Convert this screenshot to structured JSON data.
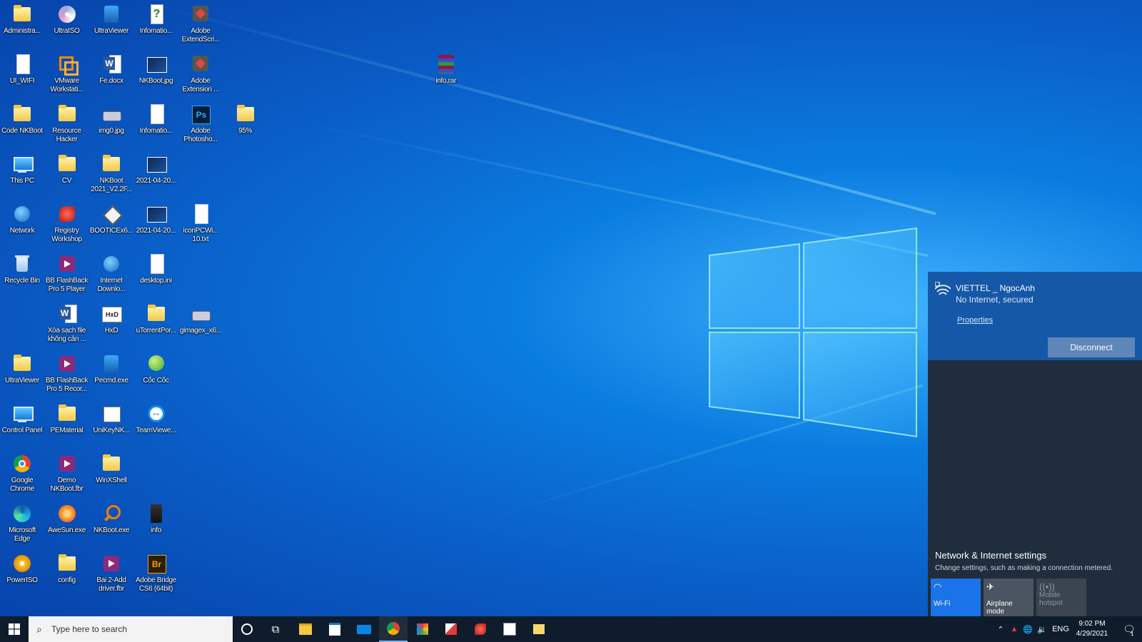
{
  "desktop_icons": [
    {
      "label": "Administra...",
      "icon": "folder-user-icon",
      "kind": "folder"
    },
    {
      "label": "UltraISO",
      "icon": "ultraiso-icon",
      "kind": "iso"
    },
    {
      "label": "UltraViewer",
      "icon": "ultraviewer-icon",
      "kind": "exe"
    },
    {
      "label": "Infomatio...",
      "icon": "help-document-icon",
      "kind": "help"
    },
    {
      "label": "Adobe\nExtendScri...",
      "icon": "adobe-extendscript-icon",
      "kind": "adobe"
    },
    {
      "label": "UI_WIFI",
      "icon": "document-icon",
      "kind": "doc"
    },
    {
      "label": "VMware\nWorkstati...",
      "icon": "vmware-icon",
      "kind": "vm"
    },
    {
      "label": "Fe.docx",
      "icon": "word-document-icon",
      "kind": "word"
    },
    {
      "label": "NKBoot.jpg",
      "icon": "image-file-icon",
      "kind": "img"
    },
    {
      "label": "Adobe\nExtension ...",
      "icon": "adobe-extension-icon",
      "kind": "adobe"
    },
    {
      "label": "info.rar",
      "icon": "winrar-archive-icon",
      "kind": "rar"
    },
    {
      "label": "Code NKBoot",
      "icon": "folder-icon",
      "kind": "folder"
    },
    {
      "label": "Resource\nHacker",
      "icon": "folder-icon",
      "kind": "folder"
    },
    {
      "label": "img0.jpg",
      "icon": "image-file-icon",
      "kind": "disk"
    },
    {
      "label": "Infomatio...",
      "icon": "document-icon",
      "kind": "doc"
    },
    {
      "label": "Adobe\nPhotosho...",
      "icon": "photoshop-icon",
      "kind": "ps"
    },
    {
      "label": "95%",
      "icon": "folder-icon",
      "kind": "folder"
    },
    {
      "label": "This PC",
      "icon": "computer-icon",
      "kind": "pc"
    },
    {
      "label": "CV",
      "icon": "folder-icon",
      "kind": "folder"
    },
    {
      "label": "NKBoot\n2021_V2.2F...",
      "icon": "folder-icon",
      "kind": "folder"
    },
    {
      "label": "2021-04-20...",
      "icon": "image-file-icon",
      "kind": "img"
    },
    {
      "label": "Network",
      "icon": "network-icon",
      "kind": "globe"
    },
    {
      "label": "Registry\nWorkshop",
      "icon": "registry-workshop-icon",
      "kind": "red"
    },
    {
      "label": "BOOTICEx6...",
      "icon": "bootice-icon",
      "kind": "diamond"
    },
    {
      "label": "2021-04-20...",
      "icon": "image-file-icon",
      "kind": "img"
    },
    {
      "label": "iconPCWi...\n10.txt",
      "icon": "text-file-icon",
      "kind": "doc"
    },
    {
      "label": "Recycle Bin",
      "icon": "recycle-bin-icon",
      "kind": "bin"
    },
    {
      "label": "BB FlashBack\nPro 5 Player",
      "icon": "flashback-player-icon",
      "kind": "flash"
    },
    {
      "label": "Internet\nDownlo...",
      "icon": "internet-download-manager-icon",
      "kind": "globe"
    },
    {
      "label": "desktop.ini",
      "icon": "settings-file-icon",
      "kind": "doc"
    },
    {
      "label": "Xóa sạch file\nkhông cần ...",
      "icon": "word-document-icon",
      "kind": "word"
    },
    {
      "label": "HxD",
      "icon": "hxd-icon",
      "kind": "hex"
    },
    {
      "label": "uTorrentPor...",
      "icon": "folder-icon",
      "kind": "folder"
    },
    {
      "label": "gimagex_x6...",
      "icon": "gimagex-icon",
      "kind": "disk"
    },
    {
      "label": "UltraViewer",
      "icon": "folder-icon",
      "kind": "folder"
    },
    {
      "label": "BB FlashBack\nPro 5 Recor...",
      "icon": "flashback-recorder-icon",
      "kind": "flash"
    },
    {
      "label": "Pecmd.exe",
      "icon": "pecmd-icon",
      "kind": "exe"
    },
    {
      "label": "Cốc Cốc",
      "icon": "coccoc-icon",
      "kind": "green"
    },
    {
      "label": "Control Panel",
      "icon": "control-panel-icon",
      "kind": "pc"
    },
    {
      "label": "PEMaterial",
      "icon": "folder-icon",
      "kind": "folder"
    },
    {
      "label": "UniKeyNK...",
      "icon": "unikey-icon",
      "kind": "key"
    },
    {
      "label": "TeamViewe...",
      "icon": "teamviewer-icon",
      "kind": "tv"
    },
    {
      "label": "Google\nChrome",
      "icon": "chrome-icon",
      "kind": "chrome"
    },
    {
      "label": "Demo\nNKBoot.fbr",
      "icon": "flashback-file-icon",
      "kind": "flash"
    },
    {
      "label": "WinXShell",
      "icon": "folder-icon",
      "kind": "folder"
    },
    {
      "label": "Microsoft\nEdge",
      "icon": "edge-icon",
      "kind": "edge"
    },
    {
      "label": "AweSun.exe",
      "icon": "awesun-icon",
      "kind": "orange"
    },
    {
      "label": "NKBoot.exe",
      "icon": "magnifier-icon",
      "kind": "magnifier"
    },
    {
      "label": "info",
      "icon": "dark-file-icon",
      "kind": "dark"
    },
    {
      "label": "PowerISO",
      "icon": "poweriso-icon",
      "kind": "poweriso"
    },
    {
      "label": "config",
      "icon": "folder-icon",
      "kind": "folder"
    },
    {
      "label": "Bai 2-Add\ndriver.fbr",
      "icon": "flashback-file-icon",
      "kind": "flash"
    },
    {
      "label": "Adobe Bridge\nCS6 (64bit)",
      "icon": "adobe-bridge-icon",
      "kind": "br"
    }
  ],
  "network_flyout": {
    "ssid": "VIETTEL _ NgocAnh",
    "status": "No Internet, secured",
    "properties_label": "Properties",
    "disconnect_label": "Disconnect",
    "settings_title": "Network & Internet settings",
    "settings_desc": "Change settings, such as making a connection metered.",
    "quick_actions": [
      {
        "label": "Wi-Fi",
        "icon": "wifi-icon",
        "active": true
      },
      {
        "label": "Airplane mode",
        "icon": "airplane-icon",
        "active": false
      },
      {
        "label": "Mobile\nhotspot",
        "icon": "hotspot-icon",
        "active": false,
        "disabled": true
      }
    ]
  },
  "taskbar": {
    "search_placeholder": "Type here to search",
    "apps": [
      "cortana-icon",
      "task-view-icon",
      "file-explorer-icon",
      "store-icon",
      "mail-icon",
      "chrome-icon",
      "paint-icon",
      "adobe-icon",
      "registry-icon",
      "unikey-icon",
      "sticky-icon"
    ],
    "active_app": "chrome-icon",
    "language": "ENG",
    "time": "9:02 PM",
    "date": "4/29/2021",
    "notification_count": "1"
  },
  "colors": {
    "flyout_bg": "#1f2d3d",
    "active_connection_bg": "#1658a8",
    "accent": "#1a73e8",
    "taskbar_bg": "#0f1c2b"
  }
}
